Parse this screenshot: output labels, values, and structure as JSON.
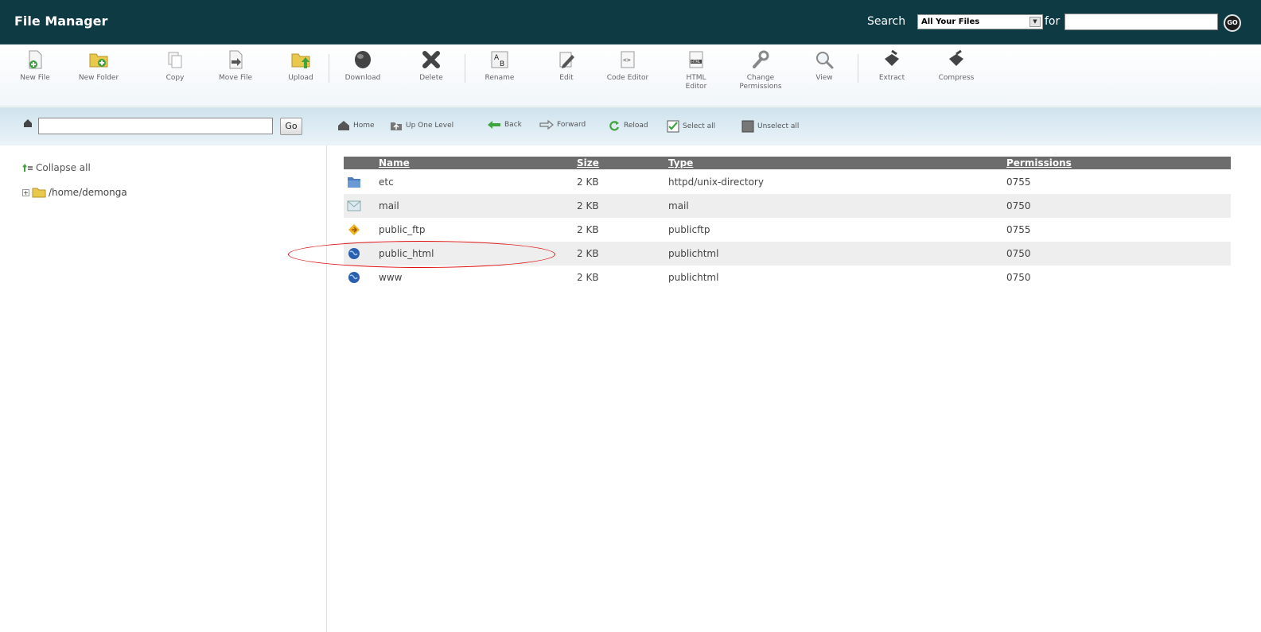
{
  "header": {
    "title": "File Manager",
    "search_label": "Search",
    "scope_value": "All Your Files",
    "for_label": "for",
    "search_value": "",
    "go_label": "GO"
  },
  "toolbar": [
    {
      "label": "New File",
      "icon": "new-file-icon"
    },
    {
      "label": "New Folder",
      "icon": "new-folder-icon"
    },
    {
      "label": "Copy",
      "icon": "copy-icon"
    },
    {
      "label": "Move File",
      "icon": "move-file-icon"
    },
    {
      "label": "Upload",
      "icon": "upload-icon"
    },
    {
      "label": "Download",
      "icon": "download-icon"
    },
    {
      "label": "Delete",
      "icon": "delete-icon"
    },
    {
      "label": "Rename",
      "icon": "rename-icon"
    },
    {
      "label": "Edit",
      "icon": "edit-icon"
    },
    {
      "label": "Code Editor",
      "icon": "code-editor-icon"
    },
    {
      "label": "HTML\nEditor",
      "icon": "html-editor-icon"
    },
    {
      "label": "Change\nPermissions",
      "icon": "change-permissions-icon"
    },
    {
      "label": "View",
      "icon": "view-icon"
    },
    {
      "label": "Extract",
      "icon": "extract-icon"
    },
    {
      "label": "Compress",
      "icon": "compress-icon"
    }
  ],
  "addressbar": {
    "path_value": "",
    "go_label": "Go"
  },
  "nav": {
    "home": "Home",
    "up": "Up One Level",
    "back": "Back",
    "forward": "Forward",
    "reload": "Reload",
    "select_all": "Select all",
    "unselect_all": "Unselect all"
  },
  "tree": {
    "collapse_label": "Collapse all",
    "root": "/home/demonga"
  },
  "table": {
    "columns": [
      "Name",
      "Size",
      "Type",
      "Permissions"
    ],
    "rows": [
      {
        "name": "etc",
        "size": "2 KB",
        "type": "httpd/unix-directory",
        "perms": "0755",
        "icon": "folder-icon"
      },
      {
        "name": "mail",
        "size": "2 KB",
        "type": "mail",
        "perms": "0750",
        "icon": "mail-icon"
      },
      {
        "name": "public_ftp",
        "size": "2 KB",
        "type": "publicftp",
        "perms": "0755",
        "icon": "ftp-icon"
      },
      {
        "name": "public_html",
        "size": "2 KB",
        "type": "publichtml",
        "perms": "0750",
        "icon": "globe-icon"
      },
      {
        "name": "www",
        "size": "2 KB",
        "type": "publichtml",
        "perms": "0750",
        "icon": "globe-icon"
      }
    ]
  },
  "colors": {
    "header_bg": "#0e3a44",
    "table_head_bg": "#6d6d6d",
    "alt_row_bg": "#eeeeee",
    "highlight": "#e01010"
  }
}
